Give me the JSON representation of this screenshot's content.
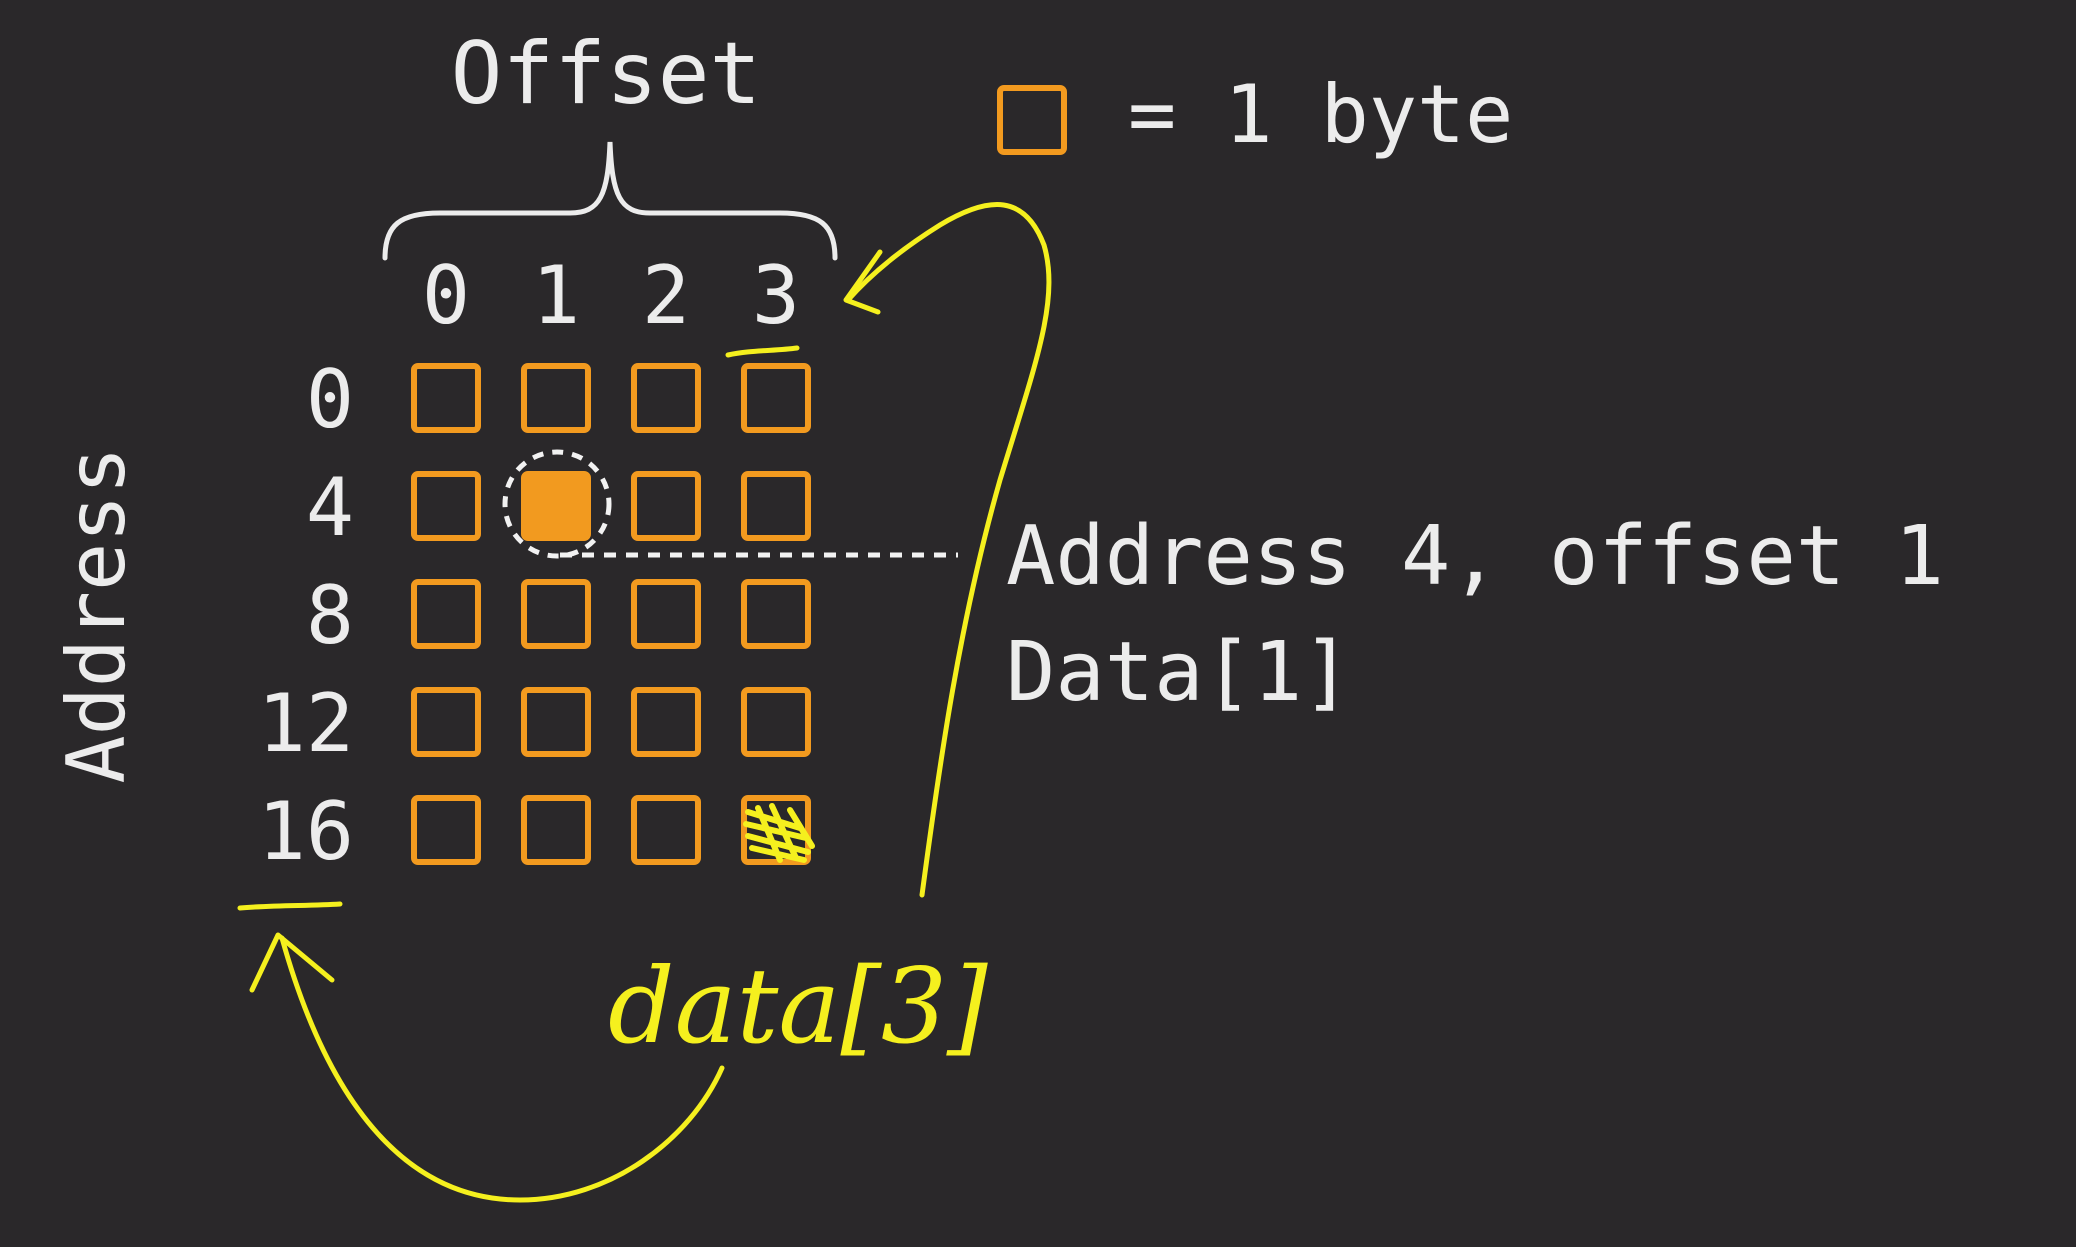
{
  "labels": {
    "offset_title": "Offset",
    "address_title": "Address",
    "legend_equals": "= 1 byte",
    "callout_line1": "Address 4, offset 1",
    "callout_line2": "Data[1]",
    "handwritten_note": "data[3]"
  },
  "columns": [
    "0",
    "1",
    "2",
    "3"
  ],
  "rows": [
    "0",
    "4",
    "8",
    "12",
    "16"
  ],
  "highlighted_cell": {
    "row": "4",
    "offset": "1"
  },
  "annotated_cell": {
    "row": "16",
    "offset": "3"
  },
  "colors": {
    "background": "#2a282a",
    "byte_box": "#f29a1f",
    "text": "#ececec",
    "annotation": "#f5f01e",
    "dashed": "#f2f2f2"
  },
  "icons": {
    "legend_box": "byte-box-icon",
    "selection_ring": "dashed-circle-icon",
    "annotation_arrows": "curved-arrow-icon"
  }
}
